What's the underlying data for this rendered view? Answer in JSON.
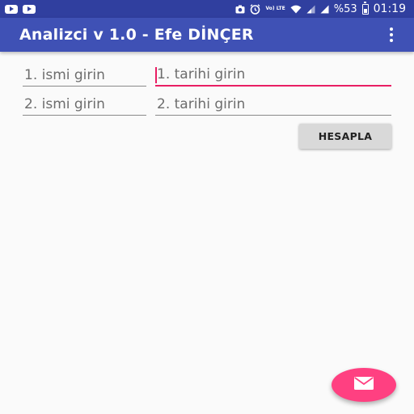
{
  "status_bar": {
    "battery": "%53",
    "time": "01:19",
    "network": "Vo) LTE",
    "icons": [
      "youtube-icon",
      "youtube-icon",
      "screenshot-icon",
      "alarm-icon",
      "wifi-icon",
      "signal-icon",
      "signal-icon",
      "battery-icon"
    ]
  },
  "app_bar": {
    "title": "Analizci v 1.0 - Efe DİNÇER",
    "menu_icon": "more-vert-icon"
  },
  "form": {
    "name1_placeholder": "1. ismi girin",
    "date1_placeholder": "1. tarihi girin",
    "name2_placeholder": "2. ismi girin",
    "date2_placeholder": "2. tarihi girin",
    "calculate_label": "HESAPLA"
  },
  "fab": {
    "icon": "email-icon"
  },
  "colors": {
    "primary": "#3f51b5",
    "primary_dark": "#303f9f",
    "accent": "#ff4081",
    "focus_underline": "#e91e63"
  }
}
